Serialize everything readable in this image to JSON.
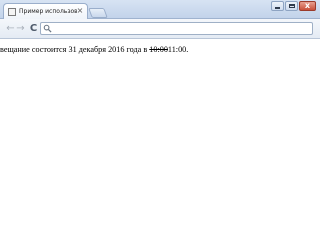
{
  "tab": {
    "title": "Пример использования атр",
    "close_label": "×"
  },
  "toolbar": {
    "back_glyph": "←",
    "forward_glyph": "→",
    "reload_glyph": "C",
    "address_value": ""
  },
  "window": {
    "close_glyph": "x"
  },
  "content": {
    "text_before": "вещание состоится 31 декабря 2016 года в ",
    "deleted_time": "10:00",
    "inserted_time": "11:00",
    "text_after": "."
  },
  "icons": {
    "tab_favicon": "page-icon",
    "omnibox_icon": "search-icon"
  }
}
